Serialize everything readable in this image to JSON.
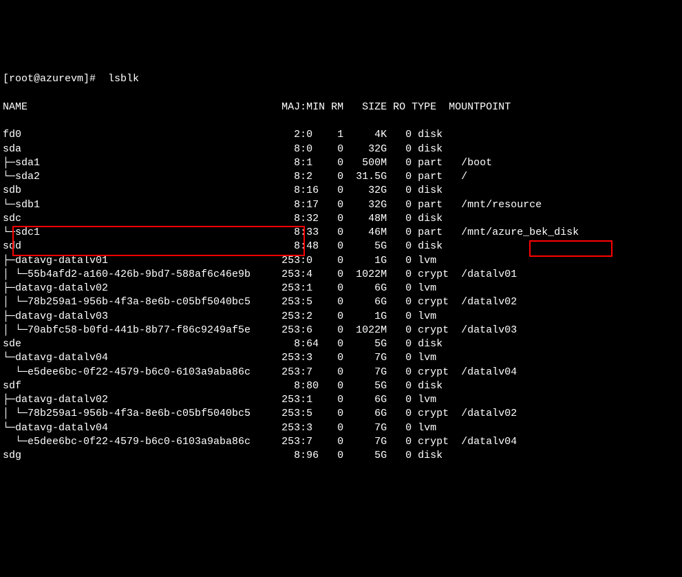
{
  "prompt": {
    "user_host": "[root@azurevm]#",
    "command": "  lsblk"
  },
  "header": {
    "name": "NAME",
    "majmin": "MAJ:MIN",
    "rm": "RM",
    "size": "SIZE",
    "ro": "RO",
    "type": "TYPE",
    "mountpoint": "MOUNTPOINT"
  },
  "rows": [
    {
      "name": "fd0",
      "majmin": "  2:0 ",
      "rm": "  1",
      "size": "    4K",
      "ro": "  0",
      "type": " disk",
      "mount": ""
    },
    {
      "name": "sda",
      "majmin": "  8:0 ",
      "rm": "  0",
      "size": "   32G",
      "ro": "  0",
      "type": " disk",
      "mount": ""
    },
    {
      "name": "├─sda1",
      "majmin": "  8:1 ",
      "rm": "  0",
      "size": "  500M",
      "ro": "  0",
      "type": " part",
      "mount": "  /boot"
    },
    {
      "name": "└─sda2",
      "majmin": "  8:2 ",
      "rm": "  0",
      "size": " 31.5G",
      "ro": "  0",
      "type": " part",
      "mount": "  /"
    },
    {
      "name": "sdb",
      "majmin": "  8:16",
      "rm": "  0",
      "size": "   32G",
      "ro": "  0",
      "type": " disk",
      "mount": ""
    },
    {
      "name": "└─sdb1",
      "majmin": "  8:17",
      "rm": "  0",
      "size": "   32G",
      "ro": "  0",
      "type": " part",
      "mount": "  /mnt/resource"
    },
    {
      "name": "sdc",
      "majmin": "  8:32",
      "rm": "  0",
      "size": "   48M",
      "ro": "  0",
      "type": " disk",
      "mount": ""
    },
    {
      "name": "└─sdc1",
      "majmin": "  8:33",
      "rm": "  0",
      "size": "   46M",
      "ro": "  0",
      "type": " part",
      "mount": "  /mnt/azure_bek_disk"
    },
    {
      "name": "sdd",
      "majmin": "  8:48",
      "rm": "  0",
      "size": "    5G",
      "ro": "  0",
      "type": " disk",
      "mount": ""
    },
    {
      "name": "├─datavg-datalv01",
      "majmin": "253:0 ",
      "rm": "  0",
      "size": "    1G",
      "ro": "  0",
      "type": " lvm",
      "mount": ""
    },
    {
      "name": "│ └─55b4afd2-a160-426b-9bd7-588af6c46e9b",
      "majmin": "253:4 ",
      "rm": "  0",
      "size": " 1022M",
      "ro": "  0",
      "type": " crypt",
      "mount": " /datalv01"
    },
    {
      "name": "├─datavg-datalv02",
      "majmin": "253:1 ",
      "rm": "  0",
      "size": "    6G",
      "ro": "  0",
      "type": " lvm",
      "mount": ""
    },
    {
      "name": "│ └─78b259a1-956b-4f3a-8e6b-c05bf5040bc5",
      "majmin": "253:5 ",
      "rm": "  0",
      "size": "    6G",
      "ro": "  0",
      "type": " crypt",
      "mount": " /datalv02"
    },
    {
      "name": "├─datavg-datalv03",
      "majmin": "253:2 ",
      "rm": "  0",
      "size": "    1G",
      "ro": "  0",
      "type": " lvm",
      "mount": ""
    },
    {
      "name": "│ └─70abfc58-b0fd-441b-8b77-f86c9249af5e",
      "majmin": "253:6 ",
      "rm": "  0",
      "size": " 1022M",
      "ro": "  0",
      "type": " crypt",
      "mount": " /datalv03"
    },
    {
      "name": "sde",
      "majmin": "  8:64",
      "rm": "  0",
      "size": "    5G",
      "ro": "  0",
      "type": " disk",
      "mount": ""
    },
    {
      "name": "└─datavg-datalv04",
      "majmin": "253:3 ",
      "rm": "  0",
      "size": "    7G",
      "ro": "  0",
      "type": " lvm",
      "mount": ""
    },
    {
      "name": "  └─e5dee6bc-0f22-4579-b6c0-6103a9aba86c",
      "majmin": "253:7 ",
      "rm": "  0",
      "size": "    7G",
      "ro": "  0",
      "type": " crypt",
      "mount": " /datalv04"
    },
    {
      "name": "sdf",
      "majmin": "  8:80",
      "rm": "  0",
      "size": "    5G",
      "ro": "  0",
      "type": " disk",
      "mount": ""
    },
    {
      "name": "├─datavg-datalv02",
      "majmin": "253:1 ",
      "rm": "  0",
      "size": "    6G",
      "ro": "  0",
      "type": " lvm",
      "mount": ""
    },
    {
      "name": "│ └─78b259a1-956b-4f3a-8e6b-c05bf5040bc5",
      "majmin": "253:5 ",
      "rm": "  0",
      "size": "    6G",
      "ro": "  0",
      "type": " crypt",
      "mount": " /datalv02"
    },
    {
      "name": "└─datavg-datalv04",
      "majmin": "253:3 ",
      "rm": "  0",
      "size": "    7G",
      "ro": "  0",
      "type": " lvm",
      "mount": ""
    },
    {
      "name": "  └─e5dee6bc-0f22-4579-b6c0-6103a9aba86c",
      "majmin": "253:7 ",
      "rm": "  0",
      "size": "    7G",
      "ro": "  0",
      "type": " crypt",
      "mount": " /datalv04"
    },
    {
      "name": "sdg",
      "majmin": "  8:96",
      "rm": "  0",
      "size": "    5G",
      "ro": "  0",
      "type": " disk",
      "mount": ""
    }
  ]
}
